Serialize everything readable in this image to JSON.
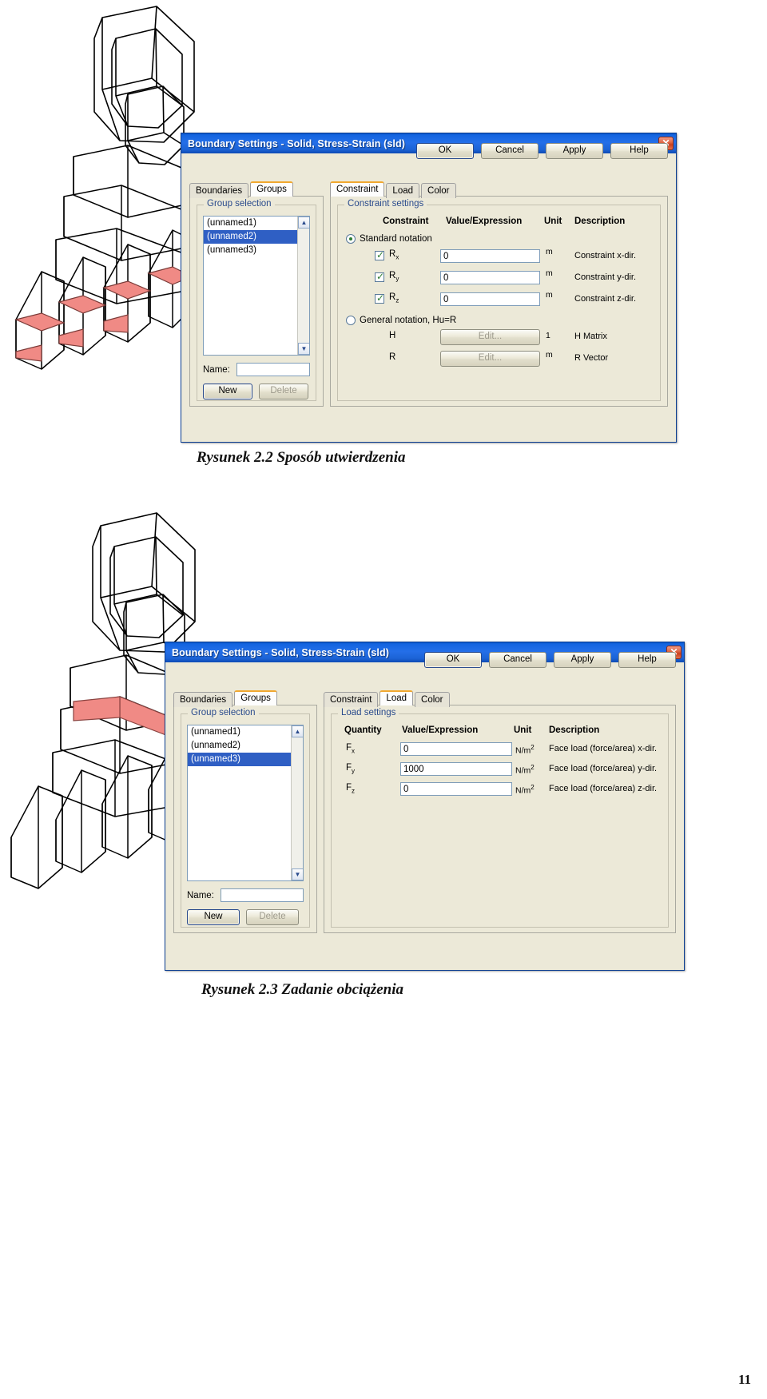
{
  "page": {
    "number": "11"
  },
  "figure1": {
    "caption": "Rysunek 2.2 Sposób utwierdzenia",
    "dialog": {
      "title": "Boundary Settings - Solid, Stress-Strain (sld)",
      "close_icon": "close-icon",
      "left_tabs": [
        {
          "label": "Boundaries",
          "active": false
        },
        {
          "label": "Groups",
          "active": true
        }
      ],
      "right_tabs": [
        {
          "label": "Constraint",
          "active": true
        },
        {
          "label": "Load",
          "active": false
        },
        {
          "label": "Color",
          "active": false
        }
      ],
      "group_selection": {
        "legend": "Group selection",
        "items": [
          {
            "label": "(unnamed1)",
            "selected": false
          },
          {
            "label": "(unnamed2)",
            "selected": true
          },
          {
            "label": "(unnamed3)",
            "selected": false
          }
        ],
        "name_label": "Name:",
        "name_value": "",
        "new_button": "New",
        "delete_button": "Delete"
      },
      "constraint_settings": {
        "legend": "Constraint settings",
        "columns": [
          "Constraint",
          "Value/Expression",
          "Unit",
          "Description"
        ],
        "standard_notation_label": "Standard notation",
        "standard_notation_selected": true,
        "rows": [
          {
            "symbol": "R",
            "subscript": "x",
            "checked": true,
            "value": "0",
            "unit": "m",
            "description": "Constraint x-dir."
          },
          {
            "symbol": "R",
            "subscript": "y",
            "checked": true,
            "value": "0",
            "unit": "m",
            "description": "Constraint y-dir."
          },
          {
            "symbol": "R",
            "subscript": "z",
            "checked": true,
            "value": "0",
            "unit": "m",
            "description": "Constraint z-dir."
          }
        ],
        "general_notation_label": "General notation, Hu=R",
        "general_notation_selected": false,
        "general_rows": [
          {
            "symbol": "H",
            "button": "Edit...",
            "unit": "1",
            "description": "H Matrix"
          },
          {
            "symbol": "R",
            "button": "Edit...",
            "unit": "m",
            "description": "R Vector"
          }
        ]
      },
      "buttons": [
        "OK",
        "Cancel",
        "Apply",
        "Help"
      ]
    }
  },
  "figure2": {
    "caption": "Rysunek 2.3 Zadanie obciążenia",
    "dialog": {
      "title": "Boundary Settings - Solid, Stress-Strain (sld)",
      "close_icon": "close-icon",
      "left_tabs": [
        {
          "label": "Boundaries",
          "active": false
        },
        {
          "label": "Groups",
          "active": true
        }
      ],
      "right_tabs": [
        {
          "label": "Constraint",
          "active": false
        },
        {
          "label": "Load",
          "active": true
        },
        {
          "label": "Color",
          "active": false
        }
      ],
      "group_selection": {
        "legend": "Group selection",
        "items": [
          {
            "label": "(unnamed1)",
            "selected": false
          },
          {
            "label": "(unnamed2)",
            "selected": false
          },
          {
            "label": "(unnamed3)",
            "selected": true
          }
        ],
        "name_label": "Name:",
        "name_value": "",
        "new_button": "New",
        "delete_button": "Delete"
      },
      "load_settings": {
        "legend": "Load settings",
        "columns": [
          "Quantity",
          "Value/Expression",
          "Unit",
          "Description"
        ],
        "rows": [
          {
            "symbol": "F",
            "subscript": "x",
            "value": "0",
            "unit_base": "N/m",
            "unit_exp": "2",
            "description": "Face load (force/area) x-dir."
          },
          {
            "symbol": "F",
            "subscript": "y",
            "value": "1000",
            "unit_base": "N/m",
            "unit_exp": "2",
            "description": "Face load (force/area) y-dir."
          },
          {
            "symbol": "F",
            "subscript": "z",
            "value": "0",
            "unit_base": "N/m",
            "unit_exp": "2",
            "description": "Face load (force/area) z-dir."
          }
        ]
      },
      "buttons": [
        "OK",
        "Cancel",
        "Apply",
        "Help"
      ]
    }
  },
  "colors": {
    "titlebar_blue": "#1364e0",
    "dialog_face": "#ece9d8",
    "selection_blue": "#2f5fc4",
    "tab_accent": "#f0a830",
    "model_highlight_red": "#f08a85",
    "legend_text": "#2a4b8d"
  }
}
